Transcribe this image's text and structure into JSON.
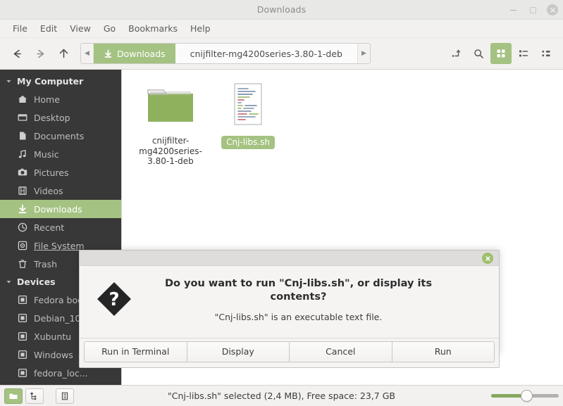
{
  "window": {
    "title": "Downloads",
    "controls": {
      "minimize": "minimize",
      "maximize": "maximize",
      "close": "close"
    }
  },
  "menubar": {
    "items": [
      {
        "label": "File"
      },
      {
        "label": "Edit"
      },
      {
        "label": "View"
      },
      {
        "label": "Go"
      },
      {
        "label": "Bookmarks"
      },
      {
        "label": "Help"
      }
    ]
  },
  "toolbar": {
    "back": "back-arrow",
    "forward": "forward-arrow",
    "up": "up-arrow",
    "path_scroll_left": "◀",
    "path_scroll_right": "▶",
    "breadcrumbs": [
      {
        "label": "Downloads",
        "icon": "downloads-arrow-icon",
        "state": "active"
      },
      {
        "label": "cnijfilter-mg4200series-3.80-1-deb",
        "icon": "",
        "state": "current"
      }
    ],
    "right_buttons": [
      {
        "name": "location-entry-toggle",
        "icon": "path-entry-icon",
        "active": false
      },
      {
        "name": "search",
        "icon": "magnifier-icon",
        "active": false
      },
      {
        "name": "icon-view",
        "icon": "grid-icon",
        "active": true
      },
      {
        "name": "list-view",
        "icon": "list-icon",
        "active": false
      },
      {
        "name": "compact-view",
        "icon": "compact-icon",
        "active": false
      }
    ]
  },
  "sidebar": {
    "groups": [
      {
        "label": "My Computer",
        "expanded": true,
        "items": [
          {
            "label": "Home",
            "icon": "home-icon",
            "selected": false,
            "hovered": false
          },
          {
            "label": "Desktop",
            "icon": "desktop-icon",
            "selected": false,
            "hovered": false
          },
          {
            "label": "Documents",
            "icon": "document-icon",
            "selected": false,
            "hovered": false
          },
          {
            "label": "Music",
            "icon": "music-note-icon",
            "selected": false,
            "hovered": false
          },
          {
            "label": "Pictures",
            "icon": "camera-icon",
            "selected": false,
            "hovered": false
          },
          {
            "label": "Videos",
            "icon": "film-icon",
            "selected": false,
            "hovered": false
          },
          {
            "label": "Downloads",
            "icon": "download-arrow-icon",
            "selected": true,
            "hovered": false
          },
          {
            "label": "Recent",
            "icon": "clock-icon",
            "selected": false,
            "hovered": false
          },
          {
            "label": "File System",
            "icon": "disk-icon",
            "selected": false,
            "hovered": true
          },
          {
            "label": "Trash",
            "icon": "trash-icon",
            "selected": false,
            "hovered": false
          }
        ]
      },
      {
        "label": "Devices",
        "expanded": true,
        "items": [
          {
            "label": "Fedora boot",
            "icon": "drive-icon",
            "selected": false,
            "hovered": false
          },
          {
            "label": "Debian_10",
            "icon": "drive-icon",
            "selected": false,
            "hovered": false
          },
          {
            "label": "Xubuntu",
            "icon": "drive-icon",
            "selected": false,
            "hovered": false
          },
          {
            "label": "Windows",
            "icon": "drive-icon",
            "selected": false,
            "hovered": false
          },
          {
            "label": "fedora_loc...",
            "icon": "drive-icon",
            "selected": false,
            "hovered": false
          }
        ]
      }
    ]
  },
  "content": {
    "files": [
      {
        "name": "cnijfilter-mg4200series-3.80-1-deb",
        "type": "folder",
        "selected": false
      },
      {
        "name": "Cnj-libs.sh",
        "type": "script",
        "selected": true
      }
    ]
  },
  "dialog": {
    "title": "",
    "close_icon": "close-icon",
    "icon": "question-mark-icon",
    "primary_text": "Do you want to run \"Cnj-libs.sh\", or display its contents?",
    "secondary_text": "\"Cnj-libs.sh\" is an executable text file.",
    "buttons": [
      {
        "label": "Run in Terminal"
      },
      {
        "label": "Display"
      },
      {
        "label": "Cancel"
      },
      {
        "label": "Run"
      }
    ]
  },
  "statusbar": {
    "view_toggles": [
      {
        "name": "icon-view-toggle",
        "icon": "folder-icon",
        "active": true
      },
      {
        "name": "detailed-list-view-toggle",
        "icon": "tree-list-icon",
        "active": false
      },
      {
        "name": "compact-view-toggle",
        "icon": "compact-list-icon",
        "active": false
      }
    ],
    "text": "\"Cnj-libs.sh\" selected (2,4 MB), Free space: 23,7 GB",
    "zoom": {
      "name": "zoom-slider",
      "value": 50
    }
  },
  "colors": {
    "accent_green": "#a4c281",
    "sidebar_bg": "#383838",
    "chrome_bg": "#f2f1f0",
    "content_bg": "#ffffff"
  }
}
